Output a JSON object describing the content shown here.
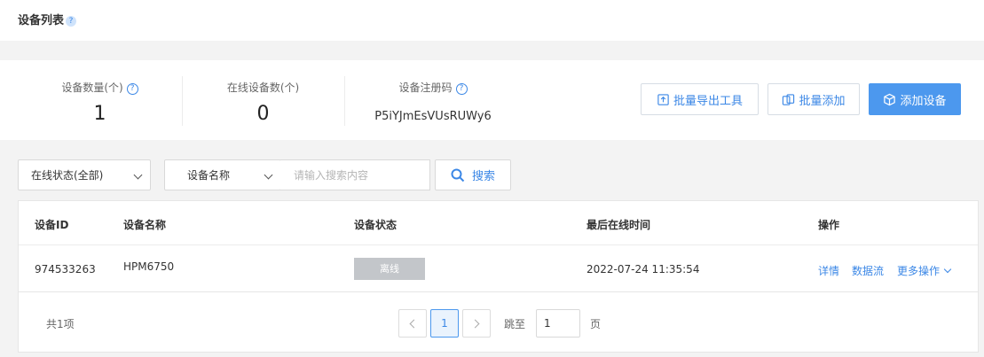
{
  "header": {
    "title": "设备列表",
    "help_glyph": "?"
  },
  "stats": {
    "device_count": {
      "label": "设备数量(个)",
      "value": "1"
    },
    "online_count": {
      "label": "在线设备数(个)",
      "value": "0"
    },
    "register_code": {
      "label": "设备注册码",
      "value": "P5iYJmEsVUsRUWy6"
    }
  },
  "toolbar": {
    "export_label": "批量导出工具",
    "batch_add_label": "批量添加",
    "add_device_label": "添加设备"
  },
  "filters": {
    "status_select": "在线状态(全部)",
    "field_select": "设备名称",
    "search_placeholder": "请输入搜索内容",
    "search_button": "搜索"
  },
  "table": {
    "columns": [
      "设备ID",
      "设备名称",
      "设备状态",
      "最后在线时间",
      "操作"
    ],
    "rows": [
      {
        "id": "974533263",
        "name": "HPM6750",
        "status": "离线",
        "last_online": "2022-07-24 11:35:54",
        "actions": [
          "详情",
          "数据流",
          "更多操作"
        ]
      }
    ]
  },
  "pagination": {
    "total_text": "共1项",
    "current_page": "1",
    "goto_label": "跳至",
    "goto_value": "1",
    "page_suffix": "页"
  },
  "colors": {
    "accent": "#4c98ee",
    "status_offline": "#c3c6ca"
  }
}
